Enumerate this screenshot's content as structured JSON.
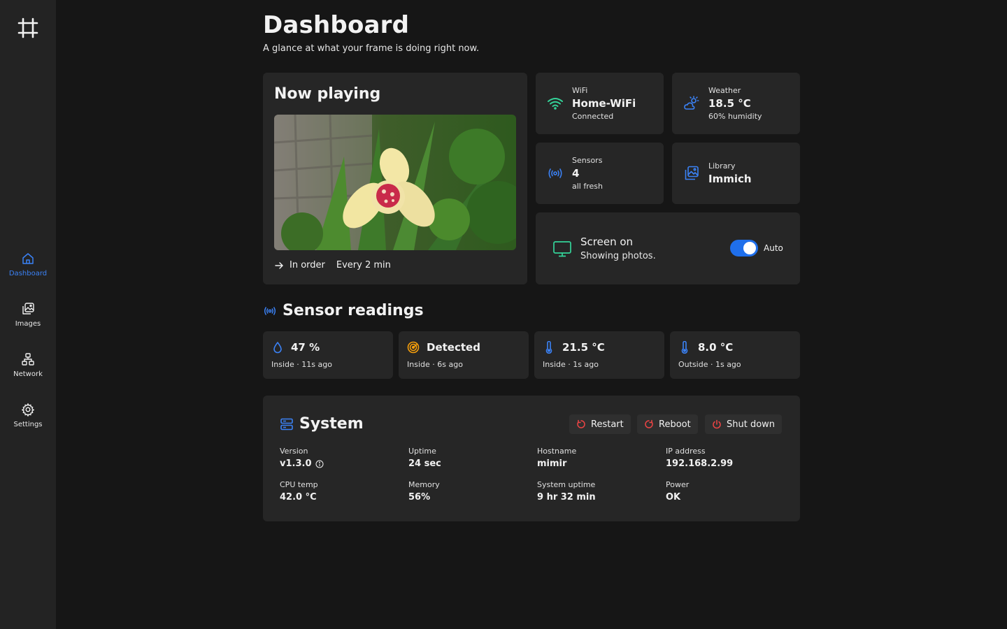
{
  "colors": {
    "accent": "#3b82f6",
    "wifi": "#34d399",
    "danger": "#ef4444",
    "warn": "#f59e0b",
    "background": "#161616",
    "card": "#262626"
  },
  "sidebar": {
    "logo_icon": "frame-grid-icon",
    "items": [
      {
        "label": "Dashboard",
        "icon": "home-icon",
        "active": true
      },
      {
        "label": "Images",
        "icon": "images-icon",
        "active": false
      },
      {
        "label": "Network",
        "icon": "network-icon",
        "active": false
      },
      {
        "label": "Settings",
        "icon": "gear-icon",
        "active": false
      }
    ]
  },
  "header": {
    "title": "Dashboard",
    "subtitle": "A glance at what your frame is doing right now."
  },
  "now_playing": {
    "title": "Now playing",
    "order": "In order",
    "interval": "Every 2 min"
  },
  "status_cards": {
    "wifi": {
      "label": "WiFi",
      "value": "Home-WiFi",
      "sub": "Connected",
      "icon": "wifi-icon"
    },
    "weather": {
      "label": "Weather",
      "value": "18.5 °C",
      "sub": "60% humidity",
      "icon": "cloud-sun-icon"
    },
    "sensors": {
      "label": "Sensors",
      "value": "4",
      "sub": "all fresh",
      "icon": "broadcast-icon"
    },
    "library": {
      "label": "Library",
      "value": "Immich",
      "icon": "library-icon"
    }
  },
  "screen": {
    "title": "Screen on",
    "sub": "Showing photos.",
    "toggle_label": "Auto",
    "toggle_on": true,
    "icon": "monitor-icon"
  },
  "sensor_readings": {
    "title": "Sensor readings",
    "items": [
      {
        "value": "47 %",
        "sub": "Inside · 11s ago",
        "icon": "droplet-icon"
      },
      {
        "value": "Detected",
        "sub": "Inside · 6s ago",
        "icon": "motion-icon"
      },
      {
        "value": "21.5 °C",
        "sub": "Inside · 1s ago",
        "icon": "thermometer-icon"
      },
      {
        "value": "8.0 °C",
        "sub": "Outside · 1s ago",
        "icon": "thermometer-icon"
      }
    ]
  },
  "system": {
    "title": "System",
    "buttons": {
      "restart": "Restart",
      "reboot": "Reboot",
      "shutdown": "Shut down"
    },
    "fields": [
      {
        "label": "Version",
        "value": "v1.3.0"
      },
      {
        "label": "Uptime",
        "value": "24 sec"
      },
      {
        "label": "Hostname",
        "value": "mimir"
      },
      {
        "label": "IP address",
        "value": "192.168.2.99"
      },
      {
        "label": "CPU temp",
        "value": "42.0 °C"
      },
      {
        "label": "Memory",
        "value": "56%"
      },
      {
        "label": "System uptime",
        "value": "9 hr 32 min"
      },
      {
        "label": "Power",
        "value": "OK"
      }
    ]
  }
}
